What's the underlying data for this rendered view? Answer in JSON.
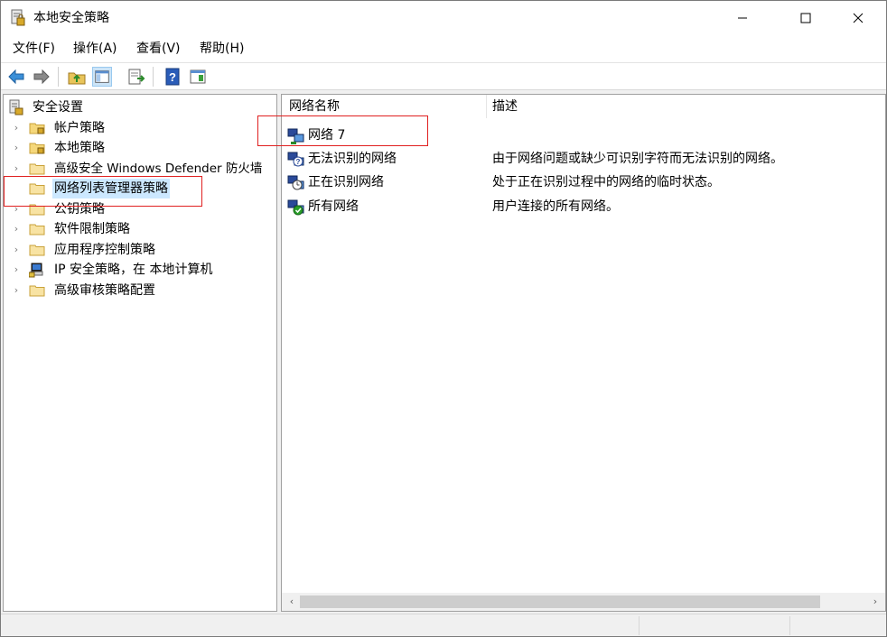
{
  "window": {
    "title": "本地安全策略",
    "icon": "security-policy-icon"
  },
  "menu": [
    "文件(F)",
    "操作(A)",
    "查看(V)",
    "帮助(H)"
  ],
  "toolbar": {
    "buttons": [
      "back-icon",
      "forward-icon",
      "up-folder-icon",
      "show-hide-tree-icon",
      "export-list-icon",
      "help-icon",
      "properties-icon"
    ]
  },
  "tree": {
    "root": "安全设置",
    "items": [
      {
        "label": "帐户策略",
        "icon": "locked-folder-icon"
      },
      {
        "label": "本地策略",
        "icon": "locked-folder-icon"
      },
      {
        "label": "高级安全 Windows Defender 防火墙",
        "icon": "folder-icon"
      },
      {
        "label": "网络列表管理器策略",
        "icon": "folder-icon",
        "selected": true
      },
      {
        "label": "公钥策略",
        "icon": "folder-icon"
      },
      {
        "label": "软件限制策略",
        "icon": "folder-icon"
      },
      {
        "label": "应用程序控制策略",
        "icon": "folder-icon"
      },
      {
        "label": "IP 安全策略，在 本地计算机",
        "icon": "ip-security-icon"
      },
      {
        "label": "高级审核策略配置",
        "icon": "folder-icon"
      }
    ]
  },
  "list": {
    "columns": [
      "网络名称",
      "描述"
    ],
    "rows": [
      {
        "name": "网络 7",
        "desc": "",
        "icon": "network-icon"
      },
      {
        "name": "无法识别的网络",
        "desc": "由于网络问题或缺少可识别字符而无法识别的网络。",
        "icon": "unidentified-network-icon"
      },
      {
        "name": "正在识别网络",
        "desc": "处于正在识别过程中的网络的临时状态。",
        "icon": "identifying-network-icon"
      },
      {
        "name": "所有网络",
        "desc": "用户连接的所有网络。",
        "icon": "all-networks-icon"
      }
    ]
  },
  "colors": {
    "highlight_border": "#e02020",
    "selection": "#cce8ff"
  }
}
